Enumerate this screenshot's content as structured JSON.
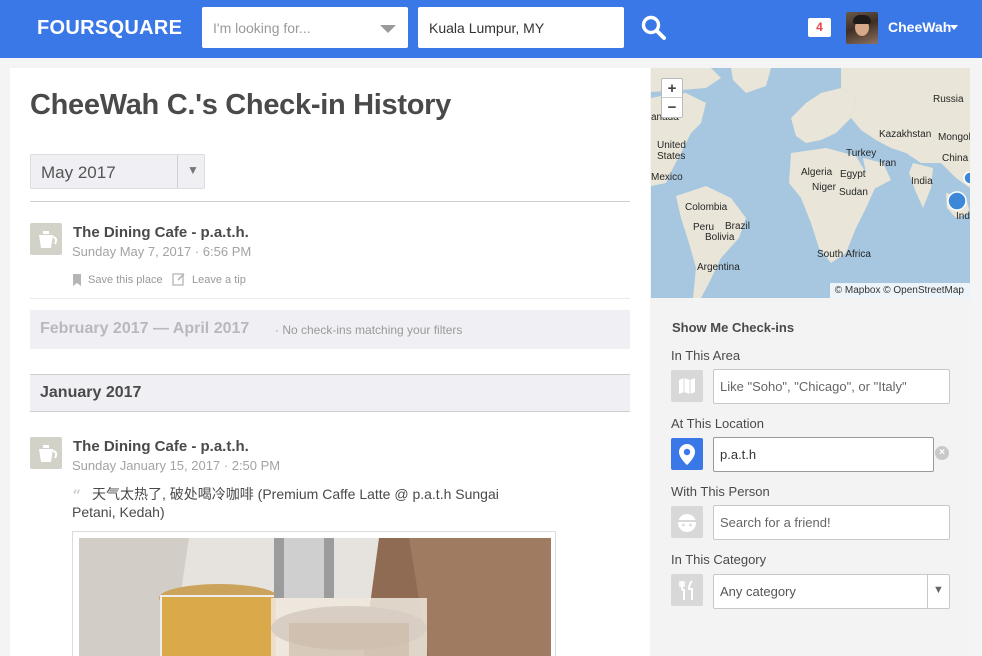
{
  "header": {
    "logo": "FOURSQUARE",
    "search_placeholder": "I'm looking for...",
    "location_value": "Kuala Lumpur, MY",
    "notification_count": "4",
    "username": "CheeWah",
    "brand_color": "#3b78e7"
  },
  "page": {
    "title": "CheeWah C.'s Check-in History",
    "month_select": "May 2017"
  },
  "checkins": [
    {
      "venue": "The Dining Cafe - p.a.t.h.",
      "datetime": "Sunday May 7, 2017 · 6:56 PM",
      "save_label": "Save this place",
      "tip_label": "Leave a tip"
    },
    {
      "venue": "The Dining Cafe - p.a.t.h.",
      "datetime": "Sunday January 15, 2017 · 2:50 PM",
      "shout": "天气太热了, 破处喝冷咖啡 (Premium Caffe Latte @ p.a.t.h Sungai Petani, Kedah)"
    }
  ],
  "empty_range": {
    "range": "February 2017 — April 2017",
    "note": "· No check-ins matching your filters"
  },
  "month_header": "January 2017",
  "map": {
    "zoom_in": "+",
    "zoom_out": "−",
    "attribution": "© Mapbox © OpenStreetMap",
    "labels": [
      "Russia",
      "Kazakhstan",
      "Mongol",
      "United States",
      "Turkey",
      "Iran",
      "China",
      "Algeria",
      "Egypt",
      "Mexico",
      "Niger",
      "Sudan",
      "India",
      "Colombia",
      "Peru",
      "Brazil",
      "Bolivia",
      "South Africa",
      "Argentina",
      "anada",
      "Indo"
    ]
  },
  "filters": {
    "title": "Show Me Check-ins",
    "area_label": "In This Area",
    "area_placeholder": "Like \"Soho\", \"Chicago\", or \"Italy\"",
    "location_label": "At This Location",
    "location_value": "p.a.t.h",
    "person_label": "With This Person",
    "person_placeholder": "Search for a friend!",
    "category_label": "In This Category",
    "category_value": "Any category"
  }
}
